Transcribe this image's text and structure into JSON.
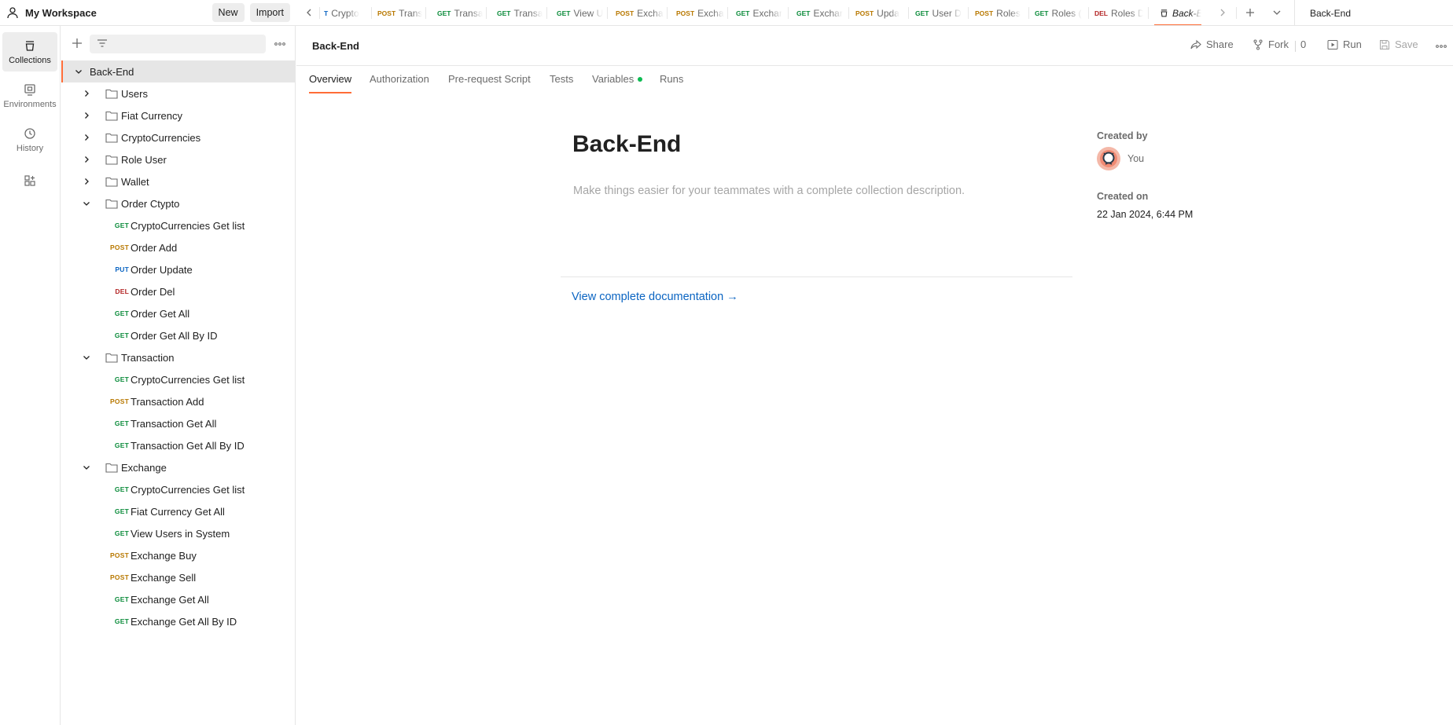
{
  "workspace": {
    "name": "My Workspace",
    "new_label": "New",
    "import_label": "Import"
  },
  "rail": {
    "collections": "Collections",
    "environments": "Environments",
    "history": "History"
  },
  "tabs": [
    {
      "method": "T",
      "name": "Crypto"
    },
    {
      "method": "POST",
      "name": "Trans"
    },
    {
      "method": "GET",
      "name": "Transa"
    },
    {
      "method": "GET",
      "name": "Transa"
    },
    {
      "method": "GET",
      "name": "View U"
    },
    {
      "method": "POST",
      "name": "Excha"
    },
    {
      "method": "POST",
      "name": "Excha"
    },
    {
      "method": "GET",
      "name": "Exchar"
    },
    {
      "method": "GET",
      "name": "Exchar"
    },
    {
      "method": "POST",
      "name": "Upda"
    },
    {
      "method": "GET",
      "name": "User D"
    },
    {
      "method": "POST",
      "name": "Roles"
    },
    {
      "method": "GET",
      "name": "Roles ("
    },
    {
      "method": "DEL",
      "name": "Roles D"
    },
    {
      "method": "",
      "name": "Back-E"
    }
  ],
  "environment": "Back-End",
  "tree": {
    "root": "Back-End",
    "folders": {
      "users": "Users",
      "fiat": "Fiat Currency",
      "crypto": "CryptoCurrencies",
      "role": "Role User",
      "wallet": "Wallet",
      "order": "Order Ctypto",
      "transaction": "Transaction",
      "exchange": "Exchange"
    },
    "order_items": [
      {
        "method": "GET",
        "name": "CryptoCurrencies Get list"
      },
      {
        "method": "POST",
        "name": "Order Add"
      },
      {
        "method": "PUT",
        "name": "Order Update"
      },
      {
        "method": "DEL",
        "name": "Order Del"
      },
      {
        "method": "GET",
        "name": "Order Get All"
      },
      {
        "method": "GET",
        "name": "Order Get All By ID"
      }
    ],
    "transaction_items": [
      {
        "method": "GET",
        "name": "CryptoCurrencies Get list"
      },
      {
        "method": "POST",
        "name": "Transaction Add"
      },
      {
        "method": "GET",
        "name": "Transaction Get All"
      },
      {
        "method": "GET",
        "name": "Transaction Get All By ID"
      }
    ],
    "exchange_items": [
      {
        "method": "GET",
        "name": "CryptoCurrencies Get list"
      },
      {
        "method": "GET",
        "name": "Fiat Currency Get All"
      },
      {
        "method": "GET",
        "name": "View Users in System"
      },
      {
        "method": "POST",
        "name": "Exchange Buy"
      },
      {
        "method": "POST",
        "name": "Exchange Sell"
      },
      {
        "method": "GET",
        "name": "Exchange Get All"
      },
      {
        "method": "GET",
        "name": "Exchange Get All By ID"
      }
    ]
  },
  "request": {
    "title": "Back-End",
    "share": "Share",
    "fork": "Fork",
    "fork_count": "0",
    "run": "Run",
    "save": "Save"
  },
  "subtabs": {
    "overview": "Overview",
    "authorization": "Authorization",
    "prerequest": "Pre-request Script",
    "tests": "Tests",
    "variables": "Variables",
    "runs": "Runs"
  },
  "overview": {
    "title": "Back-End",
    "description_placeholder": "Make things easier for your teammates with a complete collection description.",
    "docs_link": "View complete documentation →",
    "created_by_label": "Created by",
    "created_by": "You",
    "created_on_label": "Created on",
    "created_on": "22 Jan 2024, 6:44 PM"
  },
  "colors": {
    "accent": "#ff6c37",
    "get": "#0a8b3a",
    "post": "#b87800",
    "put": "#0a64c2",
    "del": "#b32424",
    "link": "#0a64c2"
  }
}
